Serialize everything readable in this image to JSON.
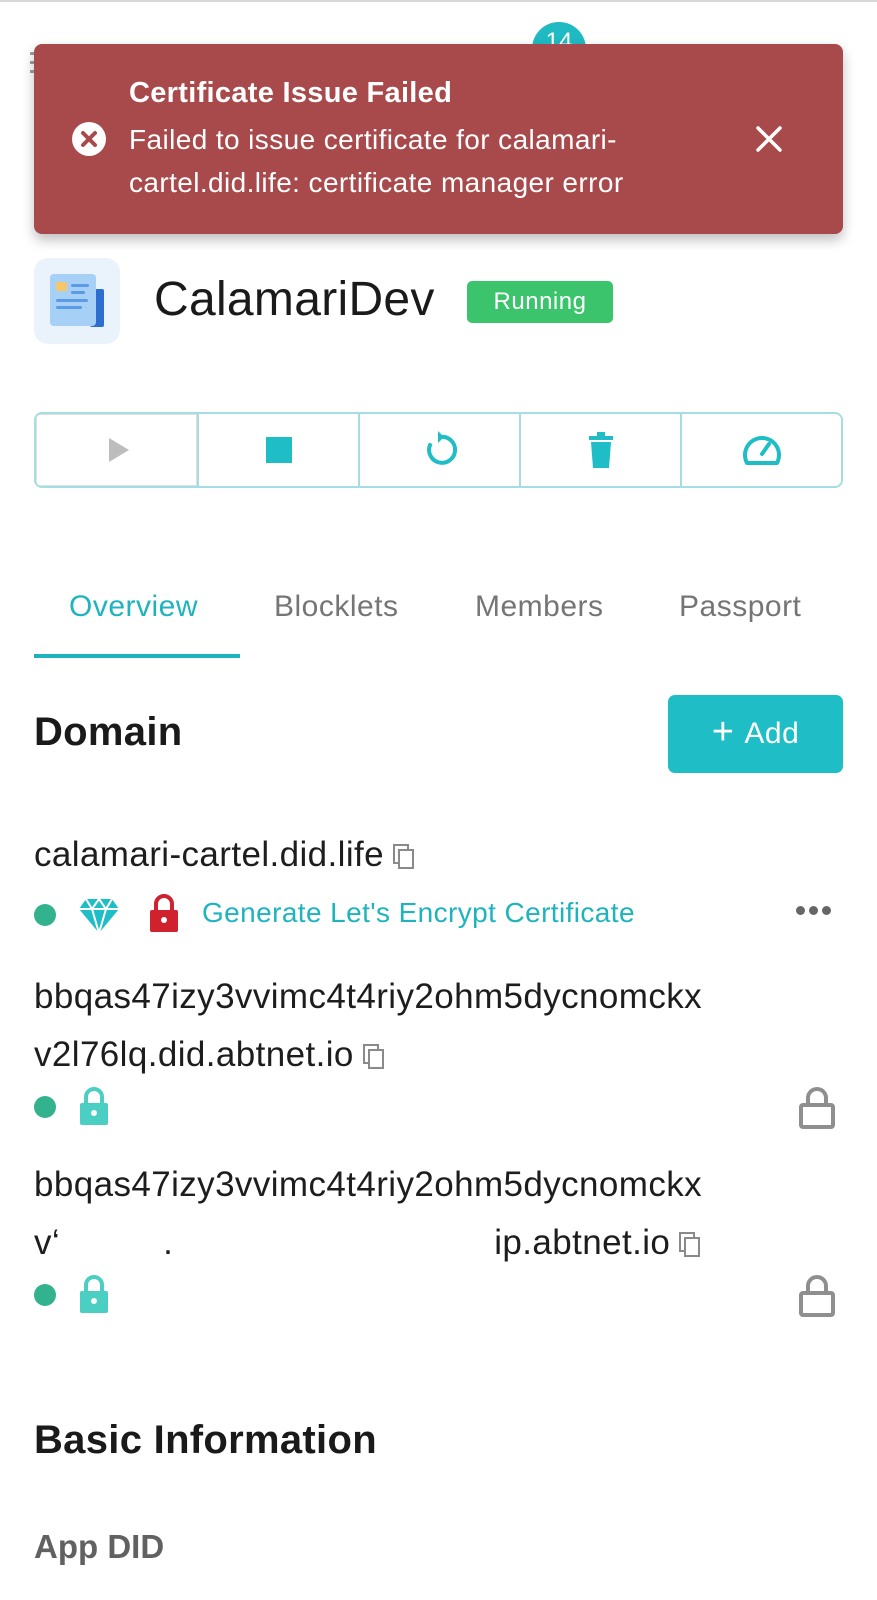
{
  "header": {
    "notification_count": "14"
  },
  "toast": {
    "title": "Certificate Issue Failed",
    "message": "Failed to issue certificate for calamari-cartel.did.life: certificate manager error"
  },
  "app": {
    "name": "CalamariDev",
    "status": "Running"
  },
  "toolbar": {
    "buttons": [
      "start",
      "stop",
      "restart",
      "delete",
      "dashboard"
    ]
  },
  "tabs": [
    "Overview",
    "Blocklets",
    "Members",
    "Passport"
  ],
  "domain": {
    "title": "Domain",
    "add_label": "Add",
    "items": [
      {
        "name": "calamari-cartel.did.life",
        "cert_action": "Generate Let's Encrypt Certificate"
      },
      {
        "name_line1": "bbqas47izy3vvimc4t4riy2ohm5dycnomckx",
        "name_line2": "v2l76lq.did.abtnet.io"
      },
      {
        "name_line1": "bbqas47izy3vvimc4t4riy2ohm5dycnomckx",
        "name_line2_start": "v‘",
        "name_line2_mid": ".",
        "name_line2_end": "ip.abtnet.io"
      }
    ]
  },
  "basic_info": {
    "title": "Basic Information",
    "app_did_label": "App DID"
  },
  "colors": {
    "accent": "#1fb4bd",
    "toast_bg": "#a84a4b",
    "running": "#3cc46d",
    "lock_red": "#d0212f"
  }
}
